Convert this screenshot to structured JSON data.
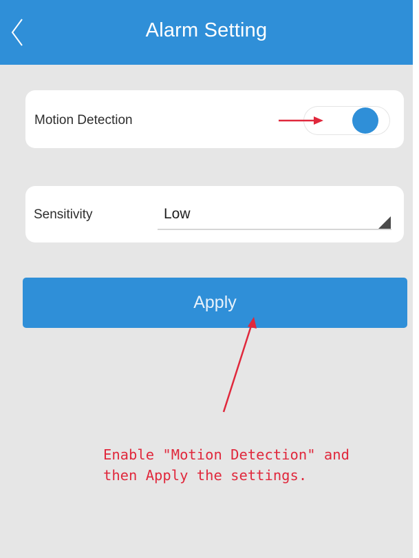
{
  "header": {
    "title": "Alarm Setting",
    "back_icon": "chevron-left-icon"
  },
  "motion_detection": {
    "label": "Motion Detection",
    "enabled": true
  },
  "sensitivity": {
    "label": "Sensitivity",
    "value": "Low"
  },
  "apply_button": {
    "label": "Apply"
  },
  "annotation": {
    "line1": "Enable \"Motion Detection\" and",
    "line2": "then Apply the settings."
  },
  "colors": {
    "accent": "#2f8fd8",
    "background": "#e6e6e6",
    "annotation": "#e0283c"
  }
}
